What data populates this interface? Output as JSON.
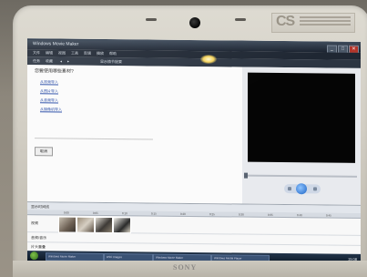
{
  "laptop": {
    "brand": "SONY",
    "sticker_logo": "CS"
  },
  "window": {
    "title": "Windows Movie Maker",
    "buttons": [
      "_",
      "□",
      "✕"
    ]
  },
  "menu": {
    "items": [
      "文件",
      "编辑",
      "视图",
      "工具",
      "剪辑",
      "播放",
      "帮助"
    ]
  },
  "toolbar": {
    "items": [
      "任务",
      "收藏",
      "◂",
      "▸",
      "显示情节提要"
    ]
  },
  "tasks": {
    "heading": "您要使用哪些素材?",
    "links": [
      "从视频导入",
      "从图片导入",
      "从音频导入",
      "从摄像机导入"
    ],
    "button_label": "取消"
  },
  "timeline": {
    "toolbar_label": "显示时间线",
    "ruler": [
      "0:00",
      "0:05",
      "0:10",
      "0:15",
      "0:20",
      "0:25",
      "0:30",
      "0:35",
      "0:40",
      "0:45"
    ],
    "tracks": [
      "视频",
      "音频/音乐",
      "片头重叠"
    ]
  },
  "taskbar": {
    "items": [
      "Windows Movie Maker",
      "DSC Images",
      "Windows Movie Maker",
      "Windows Media Player"
    ],
    "clock": "15:08"
  },
  "icons": {
    "start": "start-orb-icon",
    "play": "play-icon",
    "webcam": "webcam-icon"
  },
  "colors": {
    "bezel": "#d2cec4",
    "titlebar": "#1b2330",
    "preview": "#050505",
    "link": "#2c4fa8"
  }
}
